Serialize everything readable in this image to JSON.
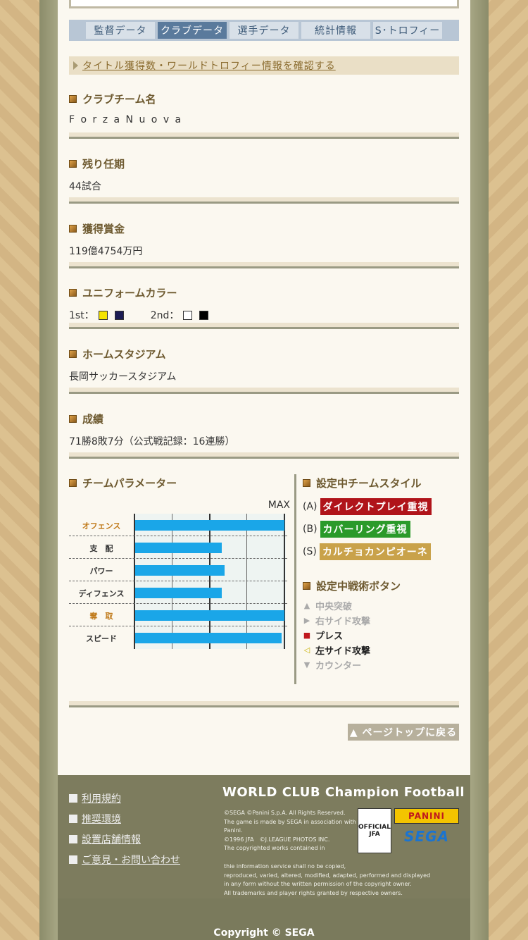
{
  "tabs": [
    "監督データ",
    "クラブデータ",
    "選手データ",
    "統計情報",
    "S･トロフィー"
  ],
  "notice": "タイトル獲得数・ワールドトロフィー情報を確認する",
  "sections": {
    "club_name": {
      "title": "クラブチーム名",
      "value": "F o r z a N u o v a"
    },
    "term": {
      "title": "残り任期",
      "value": "44試合"
    },
    "prize": {
      "title": "獲得賞金",
      "value": "119億4754万円"
    },
    "uniform": {
      "title": "ユニフォームカラー",
      "first_label": "1st：",
      "second_label": "2nd：",
      "first_colors": [
        "#f5e300",
        "#1c1c54"
      ],
      "second_colors": [
        "#ffffff",
        "#000000"
      ]
    },
    "stadium": {
      "title": "ホームスタジアム",
      "value": "長岡サッカースタジアム"
    },
    "record": {
      "title": "成績",
      "value": "71勝8敗7分（公式戦記録：16連勝）"
    }
  },
  "params": {
    "title": "チームパラメーター",
    "max_label": "MAX",
    "rows": [
      {
        "label": "オフェンス",
        "value": 1.0,
        "highlight": true
      },
      {
        "label": "支　配",
        "value": 0.58,
        "highlight": false
      },
      {
        "label": "パワー",
        "value": 0.6,
        "highlight": false
      },
      {
        "label": "ディフェンス",
        "value": 0.58,
        "highlight": false
      },
      {
        "label": "奪　取",
        "value": 1.0,
        "highlight": true
      },
      {
        "label": "スピード",
        "value": 0.98,
        "highlight": false
      }
    ]
  },
  "team_style": {
    "title": "設定中チームスタイル",
    "items": [
      {
        "key": "(A)",
        "label": "ダイレクトプレイ重視",
        "color": "#b0141a"
      },
      {
        "key": "(B)",
        "label": "カバーリング重視",
        "color": "#2a9a2a"
      },
      {
        "key": "(S)",
        "label": "カルチョカンピオーネ",
        "color": "#c9a24a"
      }
    ]
  },
  "tactics": {
    "title": "設定中戦術ボタン",
    "items": [
      {
        "label": "中央突破",
        "marker": "▲",
        "active": false
      },
      {
        "label": "右サイド攻撃",
        "marker": "▶",
        "active": false
      },
      {
        "label": "プレス",
        "marker": "■",
        "active": true,
        "marker_color": "#c0181d"
      },
      {
        "label": "左サイド攻撃",
        "marker": "◁",
        "active": true,
        "marker_color": "#c8b000"
      },
      {
        "label": "カウンター",
        "marker": "▼",
        "active": false
      }
    ]
  },
  "page_top": "▲ ページトップに戻る",
  "footer": {
    "links": [
      "利用規約",
      "推奨環境",
      "設置店舗情報",
      "ご意見・お問い合わせ"
    ],
    "brand": "WORLD CLUB Champion Football",
    "legal_top": "©SEGA ©Panini S.p.A. All Rights Reserved.\nThe game is made by SEGA in association with Panini.\n©1996 JFA　©J.LEAGUE PHOTOS INC.\nThe copyrighted works contained in",
    "legal_bottom": "thie information service shall no be copied,\nreproduced, varied, altered, modified, adapted, performed and displayed\nin any form without the written permission of the copyright owner.\nAll trademarks and player rights granted by respective owners.",
    "jfa_label": "OFFICIAL\nJFA",
    "panini_label": "PANINI",
    "sega_label": "SEGA"
  },
  "copyright": "Copyright © SEGA"
}
